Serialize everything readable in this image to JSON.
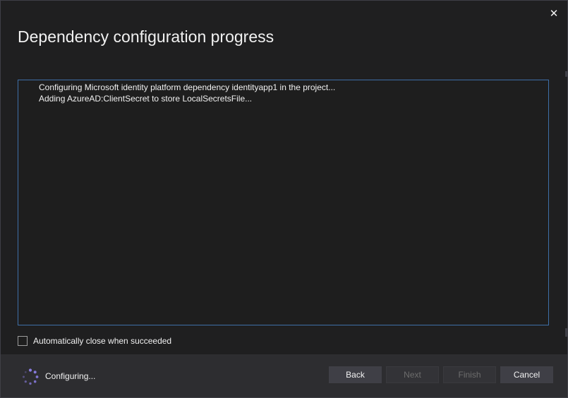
{
  "dialog": {
    "title": "Dependency configuration progress",
    "close_glyph": "✕"
  },
  "log": {
    "lines": [
      "Configuring Microsoft identity platform dependency identityapp1 in the project...",
      "Adding AzureAD:ClientSecret to store LocalSecretsFile..."
    ]
  },
  "options": {
    "auto_close_label": "Automatically close when succeeded",
    "auto_close_checked": false
  },
  "footer": {
    "status": "Configuring...",
    "spinner_color": "#8a7de3",
    "buttons": {
      "back": "Back",
      "next": "Next",
      "finish": "Finish",
      "cancel": "Cancel"
    }
  },
  "colors": {
    "background": "#1f1f20",
    "footer": "#2d2d30",
    "log_border": "#3e6fa8",
    "text": "#f1f1f1",
    "disabled_text": "#6d6d6d"
  }
}
